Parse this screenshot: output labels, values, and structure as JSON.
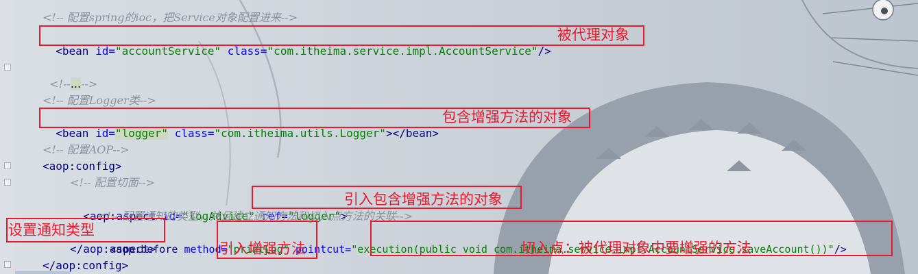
{
  "code": {
    "l1": "<!-- 配置spring的ioc，把Service对象配置进来-->",
    "l2": {
      "open": "<bean",
      "id_attr": "id=",
      "id_val": "\"accountService\"",
      "class_attr": "class=",
      "class_val": "\"com.itheima.service.impl.AccountService\"",
      "close": "/>"
    },
    "l3": {
      "open": "<!--",
      "mid": "...",
      "close": "-->"
    },
    "l4": "<!-- 配置Logger类-->",
    "l5": {
      "open": "<bean",
      "id_attr": "id=",
      "id_val": "\"logger\"",
      "class_attr": "class=",
      "class_val": "\"com.itheima.utils.Logger\"",
      "close": "></bean>"
    },
    "l6": "<!-- 配置AOP-->",
    "l7": "<aop:config>",
    "l8": "<!-- 配置切面-->",
    "l9": {
      "open": "<aop:aspect",
      "id_attr": "id=",
      "id_val": "\"logAdvice\"",
      "ref_attr": "ref=",
      "ref_val": "\"logger\"",
      "close": ">"
    },
    "l10": "<!-- 配置通知的类型，并且建立通知方法和切入点方法的关联-->",
    "l11": {
      "open": "<aop:before",
      "method_attr": "method=",
      "method_val": "\"printLog\"",
      "pointcut_attr": "pointcut=",
      "pointcut_val": "\"execution(public void com.itheima.service.impl.AccountService.saveAccount())\"",
      "close": "/>"
    },
    "l12": "</aop:aspect>",
    "l13": "</aop:config>"
  },
  "annotations": {
    "proxied_object": "被代理对象",
    "enhance_object": "包含增强方法的对象",
    "ref_enhance_object": "引入包含增强方法的对象",
    "advice_type": "设置通知类型",
    "ref_enhance_method": "引入增强方法",
    "pointcut_desc": "切入点：被代理对象中要增强的方法"
  },
  "colors": {
    "annotation_red": "#e8192c",
    "comment": "#8a929c",
    "tag": "#000080",
    "attribute": "#0000ff",
    "value": "#008000"
  }
}
